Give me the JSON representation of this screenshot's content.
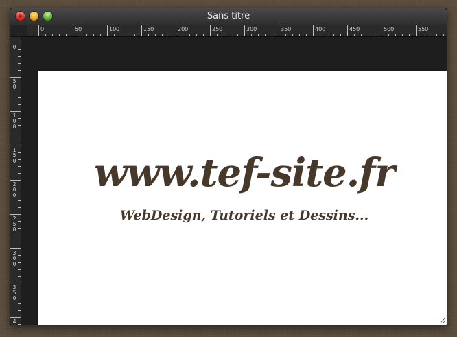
{
  "window": {
    "title": "Sans titre"
  },
  "ruler": {
    "top_labels": [
      "0",
      "50",
      "100",
      "150",
      "200",
      "250",
      "300",
      "350",
      "400",
      "450",
      "500",
      "550",
      "6"
    ],
    "left_labels": [
      "0",
      "50",
      "100",
      "150",
      "200",
      "250",
      "300",
      "350",
      "4"
    ]
  },
  "document": {
    "headline": "www.tef-site.fr",
    "tagline": "WebDesign, Tutoriels et Dessins..."
  },
  "colors": {
    "text": "#46382a",
    "desktop": "#5e5040",
    "canvas": "#ffffff"
  }
}
